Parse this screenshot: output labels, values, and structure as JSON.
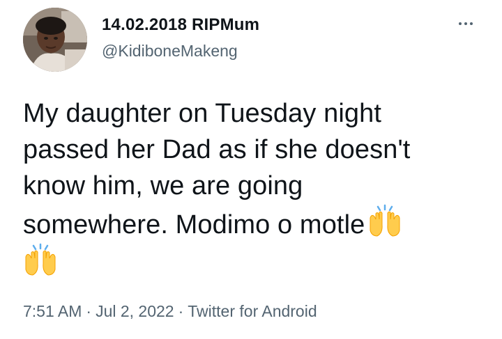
{
  "author": {
    "display_name": "14.02.2018 RIPMum",
    "handle": "@KidiboneMakeng"
  },
  "tweet": {
    "text_lines": [
      "My daughter on Tuesday night",
      "passed her Dad as if she doesn't",
      "know him, we are going",
      "somewhere. Modimo o motle"
    ],
    "emoji": "raising-hands"
  },
  "meta": {
    "time": "7:51 AM",
    "separator": "·",
    "date": "Jul 2, 2022",
    "source": "Twitter for Android"
  },
  "colors": {
    "text": "#0f1419",
    "secondary": "#536471",
    "emoji_yellow": "#ffcc4d"
  }
}
